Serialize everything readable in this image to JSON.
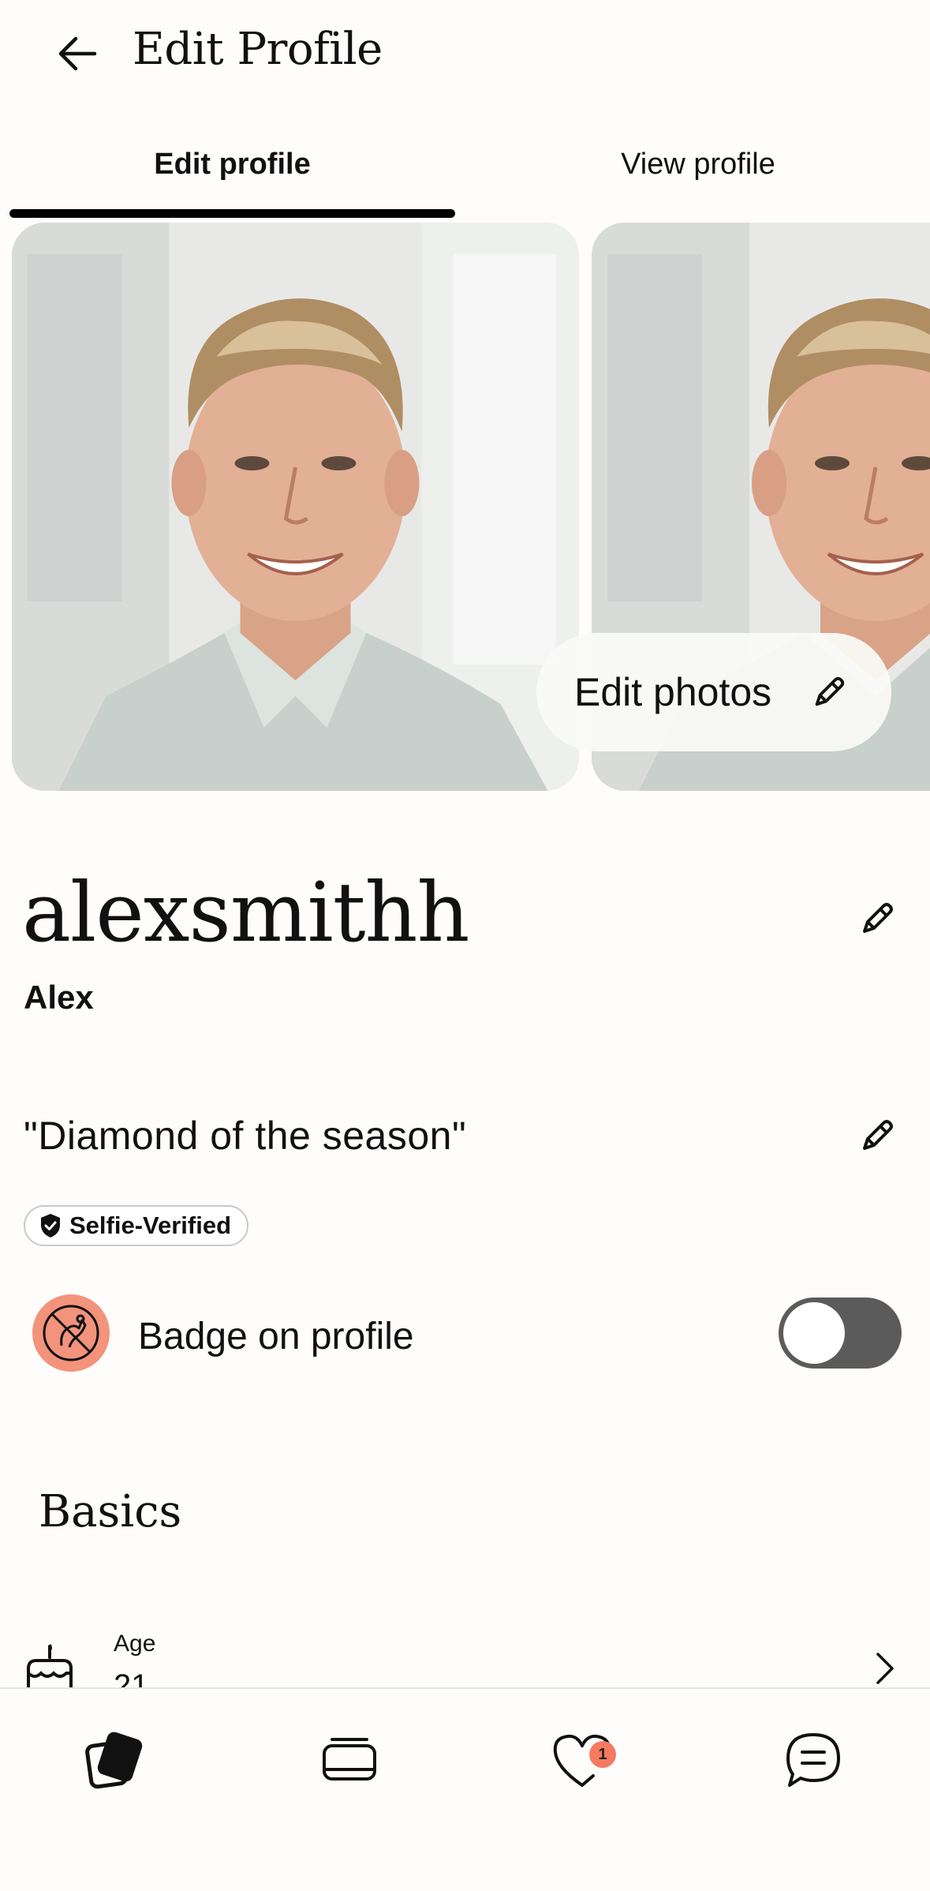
{
  "header": {
    "title": "Edit Profile"
  },
  "tabs": [
    {
      "label": "Edit profile",
      "active": true
    },
    {
      "label": "View profile",
      "active": false
    }
  ],
  "photos": {
    "edit_button_label": "Edit photos"
  },
  "profile": {
    "username": "alexsmithh",
    "display_name": "Alex",
    "quote": "\"Diamond of the season\"",
    "verified_label": "Selfie-Verified"
  },
  "badge_setting": {
    "label": "Badge on profile",
    "enabled": false
  },
  "basics": {
    "title": "Basics",
    "items": [
      {
        "label": "Age",
        "value": "21"
      }
    ]
  },
  "bottom_nav": {
    "items": [
      {
        "icon": "cards-icon",
        "active": true
      },
      {
        "icon": "stack-icon",
        "active": false
      },
      {
        "icon": "heart-icon",
        "active": false,
        "badge": "1"
      },
      {
        "icon": "chat-icon",
        "active": false
      }
    ]
  },
  "colors": {
    "background": "#fefdfb",
    "badge_accent": "#f3937c",
    "notification": "#f57a60",
    "toggle_off": "#5b5b5b"
  }
}
